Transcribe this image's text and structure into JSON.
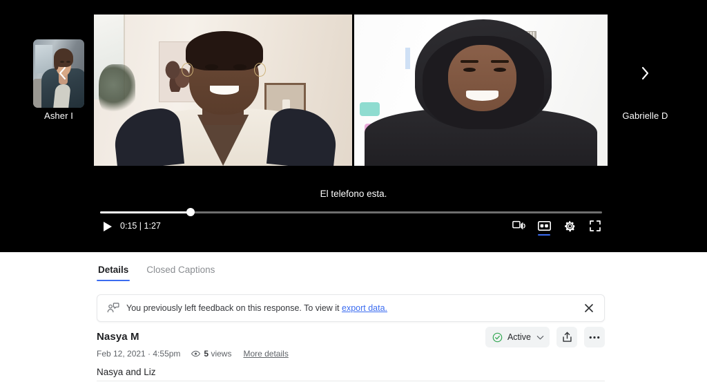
{
  "player": {
    "participants": {
      "prev_nav_icon": "chevron-left-icon",
      "next_nav_icon": "chevron-right-icon",
      "left_label": "Asher I",
      "right_label": "Gabrielle D"
    },
    "caption_text": "El telefono esta.",
    "play_icon": "play-icon",
    "current_time": "0:15",
    "time_separator": "|",
    "duration": "1:27",
    "time_display": "0:15 | 1:27",
    "progress_percent": 18,
    "controls": [
      {
        "name": "cast-icon",
        "label": "Cast"
      },
      {
        "name": "closed-captions-icon",
        "label": "CC",
        "active": true
      },
      {
        "name": "settings-gear-icon",
        "label": "Settings"
      },
      {
        "name": "fullscreen-icon",
        "label": "Fullscreen"
      }
    ],
    "cc_active_color": "#3b6cf0"
  },
  "tabs": [
    {
      "label": "Details",
      "active": true
    },
    {
      "label": "Closed Captions",
      "active": false
    }
  ],
  "banner": {
    "icon": "feedback-person-icon",
    "text": "You previously left feedback on this response. To view it ",
    "link_text": "export data.",
    "close_icon": "close-icon",
    "link_color": "#3b6cf0"
  },
  "details": {
    "title": "Nasya M",
    "date": "Feb 12, 2021 · 4:55pm",
    "views_icon": "eye-icon",
    "views_count": "5",
    "views_label": " views",
    "more_details": "More details",
    "description": "Nasya and Liz"
  },
  "actions": {
    "status_icon": "check-circle-icon",
    "status_label": "Active",
    "status_color": "#34a853",
    "chevron_icon": "chevron-down-icon",
    "share_icon": "share-upload-icon",
    "overflow_icon": "more-horizontal-icon"
  }
}
